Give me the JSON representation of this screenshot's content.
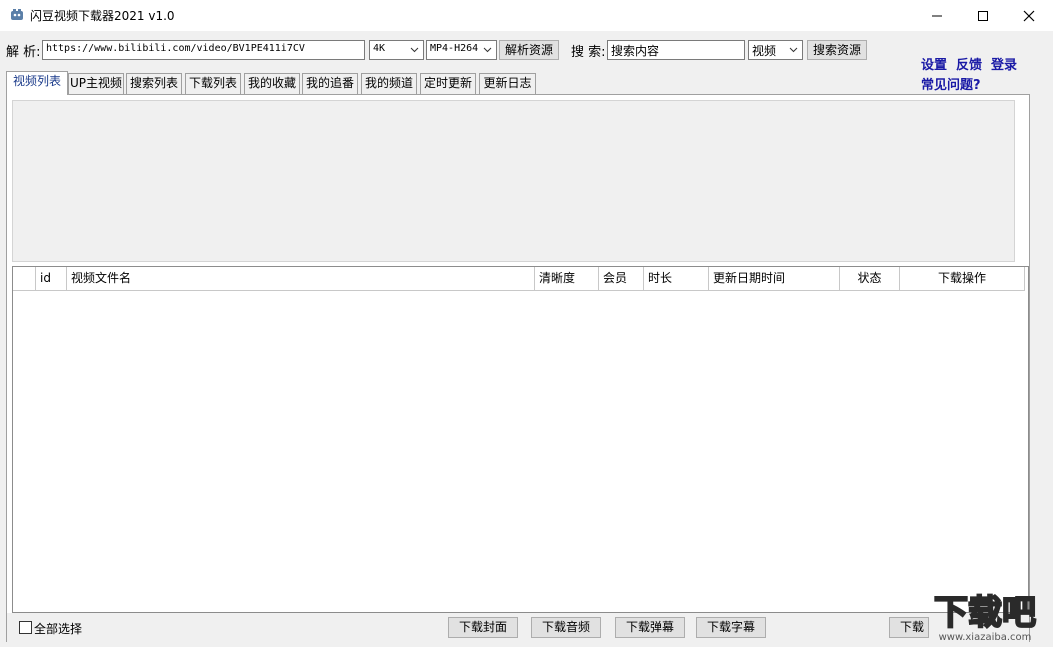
{
  "window": {
    "title": "闪豆视频下载器2021 v1.0"
  },
  "toolbar": {
    "parse_label": "解 析:",
    "url_value": "https://www.bilibili.com/video/BV1PE411i7CV",
    "quality_selected": "4K",
    "format_selected": "MP4-H264",
    "parse_button": "解析资源",
    "search_label": "搜 索:",
    "search_placeholder": "搜索内容",
    "search_type_selected": "视频",
    "search_button": "搜索资源"
  },
  "links": {
    "settings": "设置",
    "feedback": "反馈",
    "login": "登录",
    "faq": "常见问题?"
  },
  "tabs": [
    {
      "label": "视频列表",
      "active": true
    },
    {
      "label": "UP主视频"
    },
    {
      "label": "搜索列表"
    },
    {
      "label": "下载列表"
    },
    {
      "label": "我的收藏"
    },
    {
      "label": "我的追番"
    },
    {
      "label": "我的频道"
    },
    {
      "label": "定时更新"
    },
    {
      "label": "更新日志"
    }
  ],
  "table": {
    "columns": [
      "id",
      "视频文件名",
      "清晰度",
      "会员",
      "时长",
      "更新日期时间",
      "状态",
      "下载操作"
    ],
    "rows": []
  },
  "bottom": {
    "select_all": "全部选择",
    "download_cover": "下载封面",
    "download_audio": "下载音频",
    "download_danmaku": "下载弹幕",
    "download_subtitle": "下载字幕",
    "download_partial": "下载"
  },
  "watermark": {
    "text": "下载吧",
    "url": "www.xiazaiba.com"
  },
  "colors": {
    "link": "#1a1aa6",
    "active_tab_text": "#1a3a8a",
    "window_bg": "#f0f0f0"
  }
}
